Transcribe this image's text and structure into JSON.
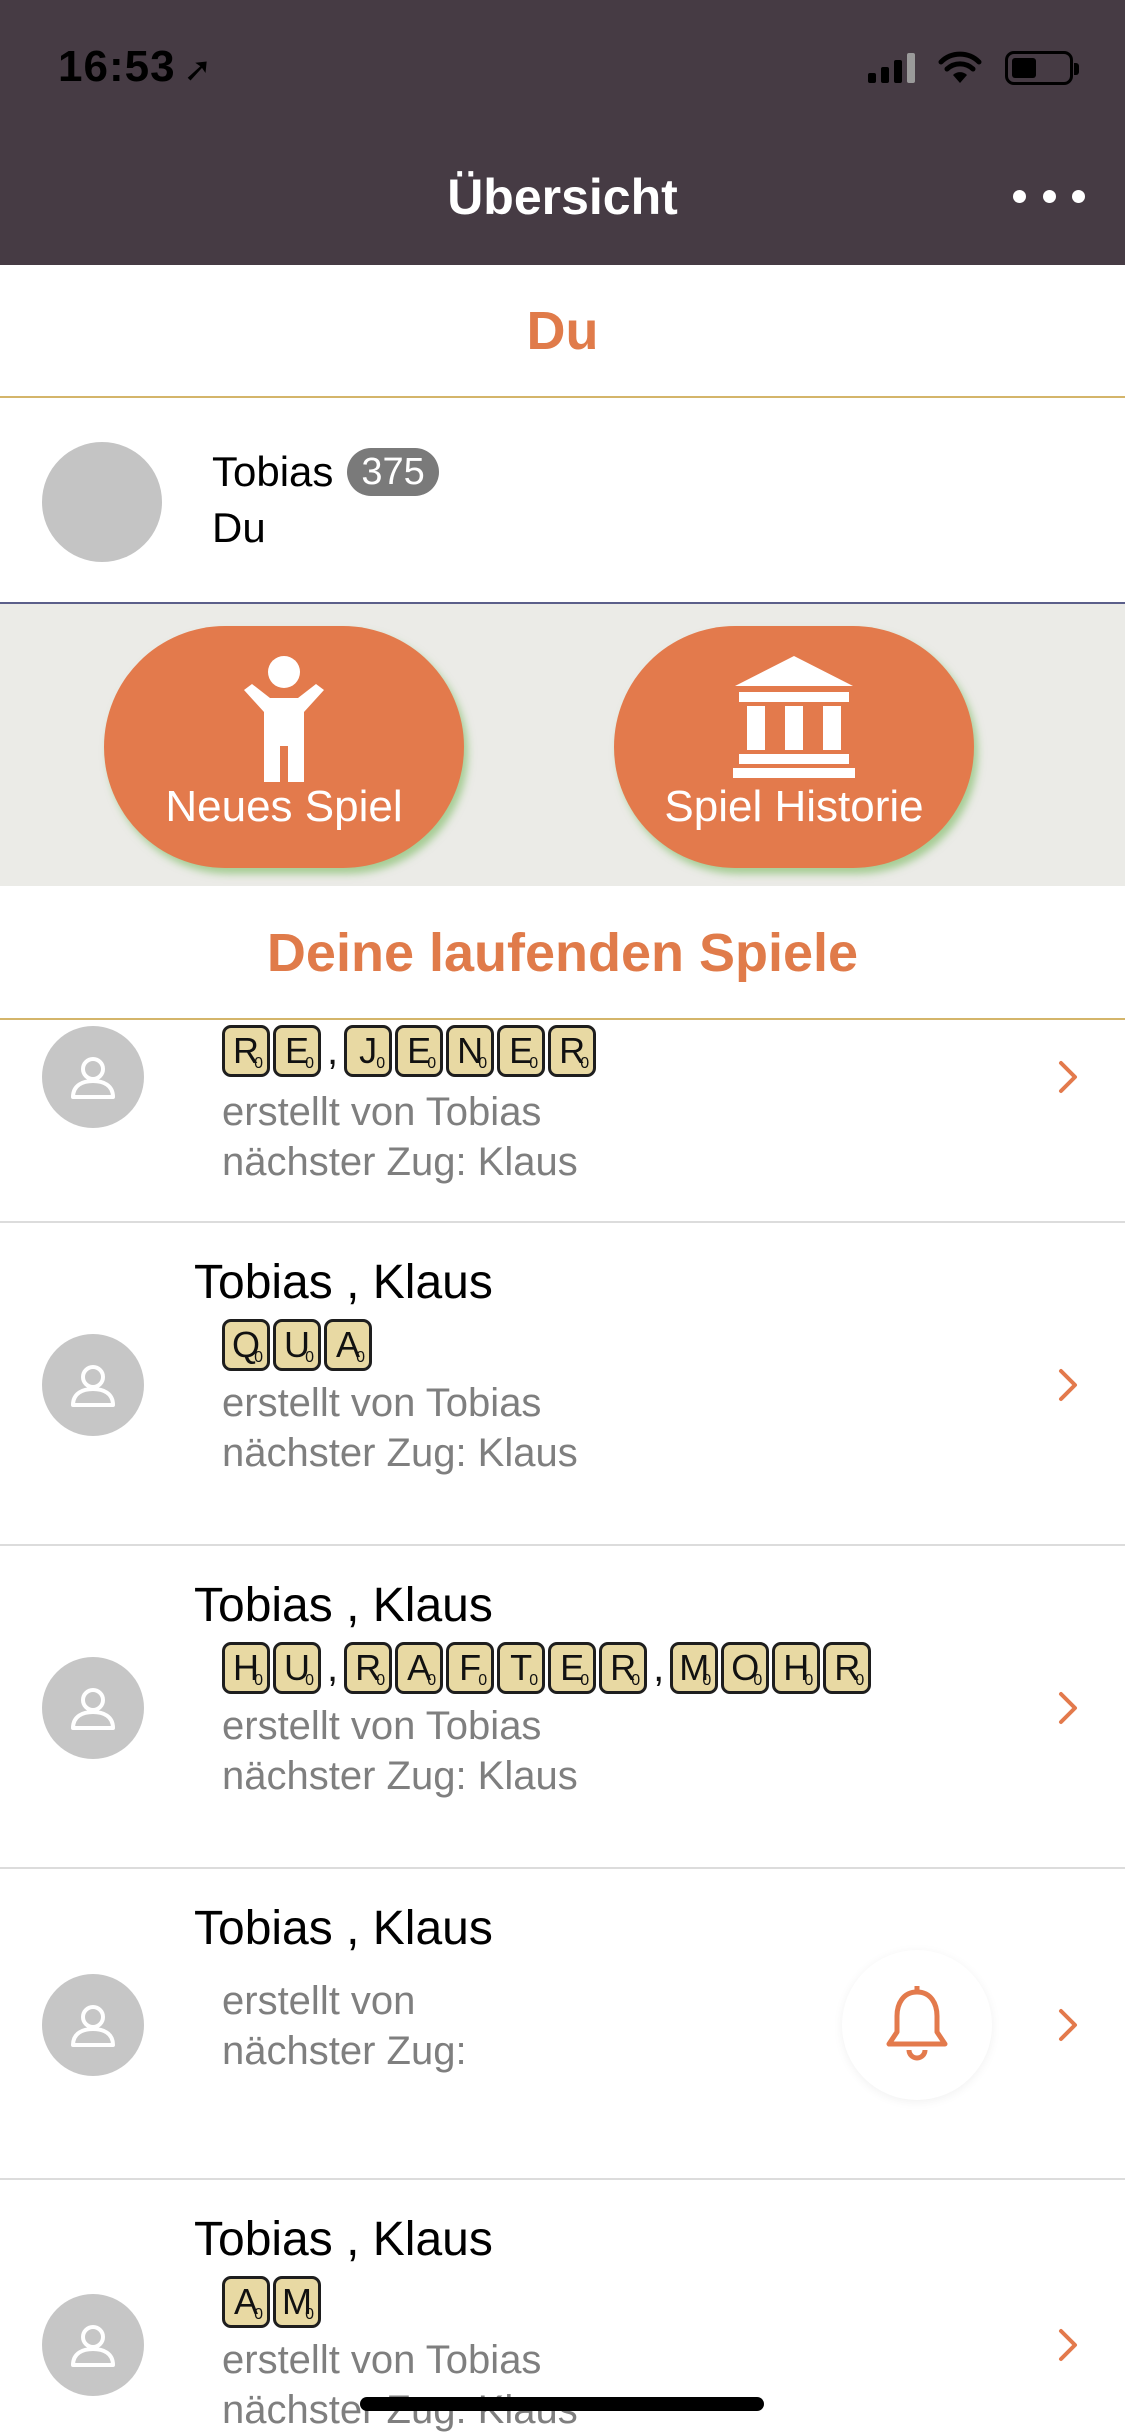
{
  "status_bar": {
    "time": "16:53",
    "location_glyph": "➚"
  },
  "nav": {
    "title": "Übersicht",
    "more_icon": "more-horizontal-icon"
  },
  "section_you": {
    "title": "Du"
  },
  "profile": {
    "name": "Tobias",
    "score": "375",
    "subtitle": "Du"
  },
  "actions": {
    "new_game": "Neues Spiel",
    "history": "Spiel Historie"
  },
  "section_games": {
    "title": "Deine laufenden Spiele"
  },
  "colors": {
    "accent": "#e37a4c",
    "navbar": "#463b44",
    "band": "#ebebe7",
    "tile": "#e8d9a3"
  },
  "games": [
    {
      "title": "",
      "words": [
        {
          "letters": [
            "R",
            "E"
          ]
        },
        {
          "letters": [
            "J",
            "E",
            "N",
            "E",
            "R"
          ]
        }
      ],
      "created_by": "erstellt von Tobias",
      "next_turn": "nächster Zug: Klaus"
    },
    {
      "title": "Tobias , Klaus",
      "words": [
        {
          "letters": [
            "Q",
            "U",
            "A"
          ]
        }
      ],
      "created_by": "erstellt von Tobias",
      "next_turn": "nächster Zug: Klaus"
    },
    {
      "title": "Tobias , Klaus",
      "words": [
        {
          "letters": [
            "H",
            "U"
          ]
        },
        {
          "letters": [
            "R",
            "A",
            "F",
            "T",
            "E",
            "R"
          ]
        },
        {
          "letters": [
            "M",
            "O",
            "H",
            "R"
          ]
        }
      ],
      "created_by": "erstellt von Tobias",
      "next_turn": "nächster Zug: Klaus"
    },
    {
      "title": "Tobias , Klaus",
      "words": [],
      "created_by": "erstellt von",
      "next_turn": "nächster Zug:"
    },
    {
      "title": "Tobias , Klaus",
      "words": [
        {
          "letters": [
            "A",
            "M"
          ]
        }
      ],
      "created_by": "erstellt von Tobias",
      "next_turn": "nächster Zug: Klaus"
    }
  ]
}
